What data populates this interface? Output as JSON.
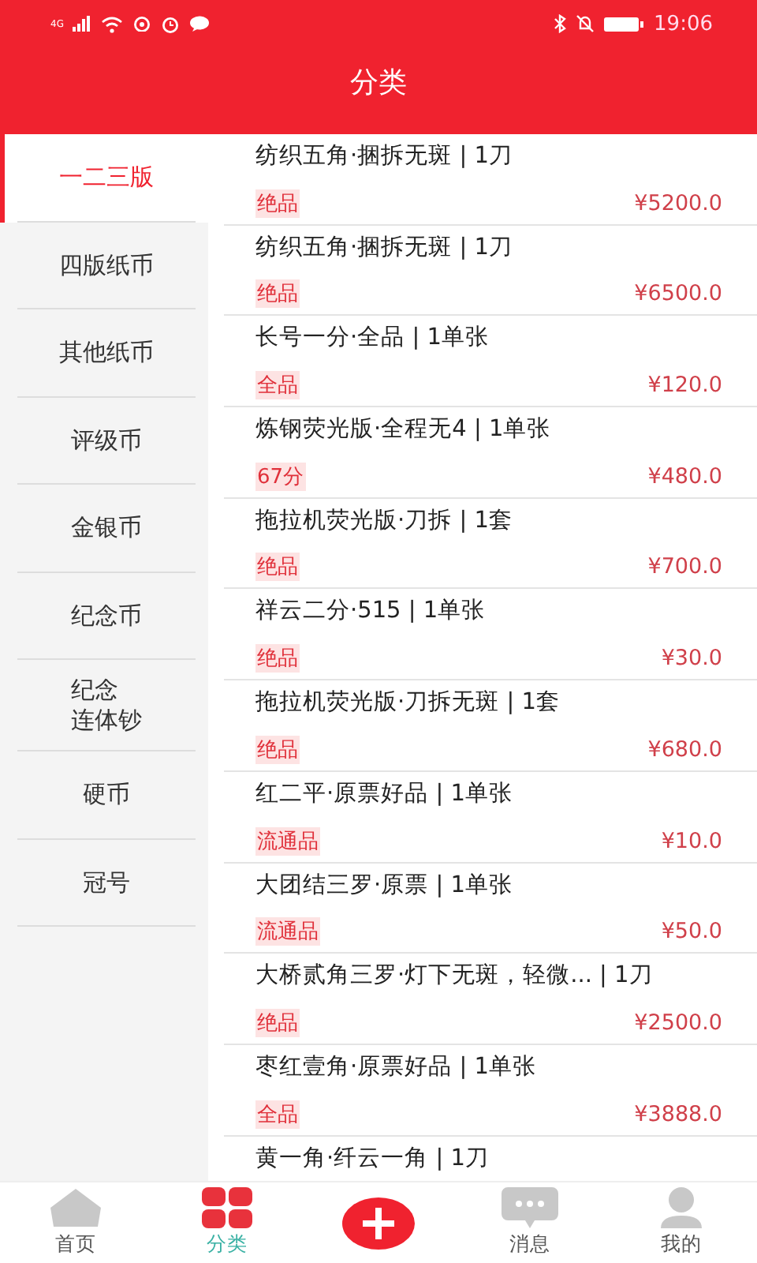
{
  "status_bar": {
    "network": "4G",
    "time": "19:06"
  },
  "header": {
    "title": "分类"
  },
  "sidebar": {
    "items": [
      {
        "label": "一二三版",
        "selected": true
      },
      {
        "label": "四版纸币",
        "selected": false
      },
      {
        "label": "其他纸币",
        "selected": false
      },
      {
        "label": "评级币",
        "selected": false
      },
      {
        "label": "金银币",
        "selected": false
      },
      {
        "label": "纪念币",
        "selected": false
      },
      {
        "lines": [
          "纪念",
          "连体钞"
        ],
        "selected": false
      },
      {
        "label": "硬币",
        "selected": false
      },
      {
        "label": "冠号",
        "selected": false
      }
    ]
  },
  "products": [
    {
      "title": "纺织五角·捆拆无斑 | 1刀",
      "grade": "绝品",
      "price": "¥5200.0"
    },
    {
      "title": "纺织五角·捆拆无斑 | 1刀",
      "grade": "绝品",
      "price": "¥6500.0"
    },
    {
      "title": "长号一分·全品 | 1单张",
      "grade": "全品",
      "price": "¥120.0"
    },
    {
      "title": "炼钢荧光版·全程无4 | 1单张",
      "grade": "67分",
      "price": "¥480.0"
    },
    {
      "title": "拖拉机荧光版·刀拆 | 1套",
      "grade": "绝品",
      "price": "¥700.0"
    },
    {
      "title": "祥云二分·515 | 1单张",
      "grade": "绝品",
      "price": "¥30.0"
    },
    {
      "title": "拖拉机荧光版·刀拆无斑 | 1套",
      "grade": "绝品",
      "price": "¥680.0"
    },
    {
      "title": "红二平·原票好品 | 1单张",
      "grade": "流通品",
      "price": "¥10.0"
    },
    {
      "title": "大团结三罗·原票 | 1单张",
      "grade": "流通品",
      "price": "¥50.0"
    },
    {
      "title": "大桥贰角三罗·灯下无斑，轻微... | 1刀",
      "grade": "绝品",
      "price": "¥2500.0"
    },
    {
      "title": "枣红壹角·原票好品 | 1单张",
      "grade": "全品",
      "price": "¥3888.0"
    },
    {
      "title": "黄一角·纤云一角 | 1刀"
    }
  ],
  "tab_bar": [
    {
      "kind": "home",
      "label": "首页",
      "selected": false
    },
    {
      "kind": "category",
      "label": "分类",
      "selected": true
    },
    {
      "kind": "add"
    },
    {
      "kind": "message",
      "label": "消息",
      "selected": false
    },
    {
      "kind": "profile",
      "label": "我的",
      "selected": false
    }
  ]
}
